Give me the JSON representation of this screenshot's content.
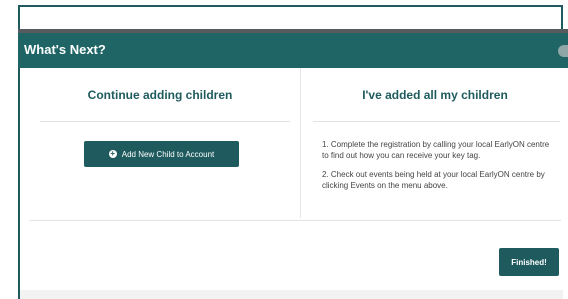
{
  "header": {
    "title": "What's Next?"
  },
  "left": {
    "heading": "Continue adding children",
    "add_button_label": "Add New Child to Account"
  },
  "right": {
    "heading": "I've added all my children",
    "steps": [
      "1. Complete the registration by calling your local EarlyON centre to find out how you can receive your key tag.",
      "2. Check out events being held at your local EarlyON centre by clicking Events on the menu above."
    ]
  },
  "footer": {
    "finish_label": "Finished!"
  },
  "icons": {
    "add": "plus-circle-icon",
    "close": "close-icon"
  },
  "colors": {
    "primary": "#1f5b5e",
    "header_bg": "#1f6566"
  }
}
